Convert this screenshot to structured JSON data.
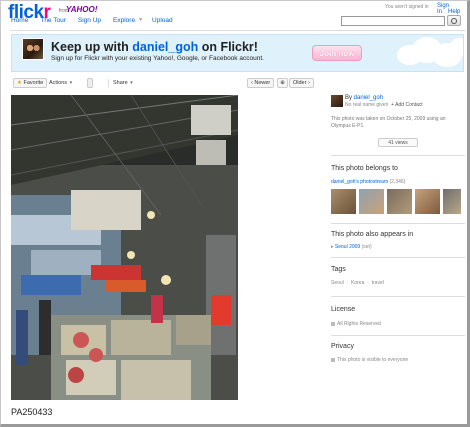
{
  "header": {
    "logo_text_main": "flick",
    "logo_text_r": "r",
    "logo_from": "from",
    "logo_yahoo": "YAHOO!",
    "nav": [
      {
        "label": "Home"
      },
      {
        "label": "The Tour"
      },
      {
        "label": "Sign Up"
      },
      {
        "label": "Explore"
      },
      {
        "label": "Upload"
      }
    ],
    "not_signed_in": "You aren't signed in",
    "sign_in": "Sign In",
    "help": "Help",
    "search_placeholder": ""
  },
  "banner": {
    "title_prefix": "Keep up with ",
    "username": "daniel_goh",
    "title_suffix": " on Flickr!",
    "subtitle": "Sign up for Flickr with your existing Yahoo!, Google, or Facebook account.",
    "join_label": "Join now"
  },
  "toolbar": {
    "favorite": "Favorite",
    "actions": "Actions",
    "share": "Share",
    "newer": "Newer",
    "older": "Older"
  },
  "photo": {
    "caption": "PA250433"
  },
  "owner": {
    "by": "By ",
    "username": "daniel_goh",
    "real_name": "No real name given",
    "add_contact": "+ Add Contact",
    "taken_text": "This photo was taken on October 25, 2009 using an Olympus E-P1.",
    "views": "41 views"
  },
  "sidebar": {
    "belongs_heading": "This photo belongs to",
    "photostream_label": "daniel_goh's photostream",
    "photostream_count": "(2,346)",
    "also_heading": "This photo also appears in",
    "set_label": "Seoul 2009",
    "set_suffix": "(set)",
    "tags_heading": "Tags",
    "tags": [
      "Seoul",
      "Korea",
      "travel"
    ],
    "license_heading": "License",
    "license_text": "All Rights Reserved",
    "privacy_heading": "Privacy",
    "privacy_text": "This photo is visible to everyone"
  },
  "colors": {
    "flickr_blue": "#0063dc",
    "flickr_pink": "#ff0084",
    "banner_bg": "#dff1fb"
  }
}
